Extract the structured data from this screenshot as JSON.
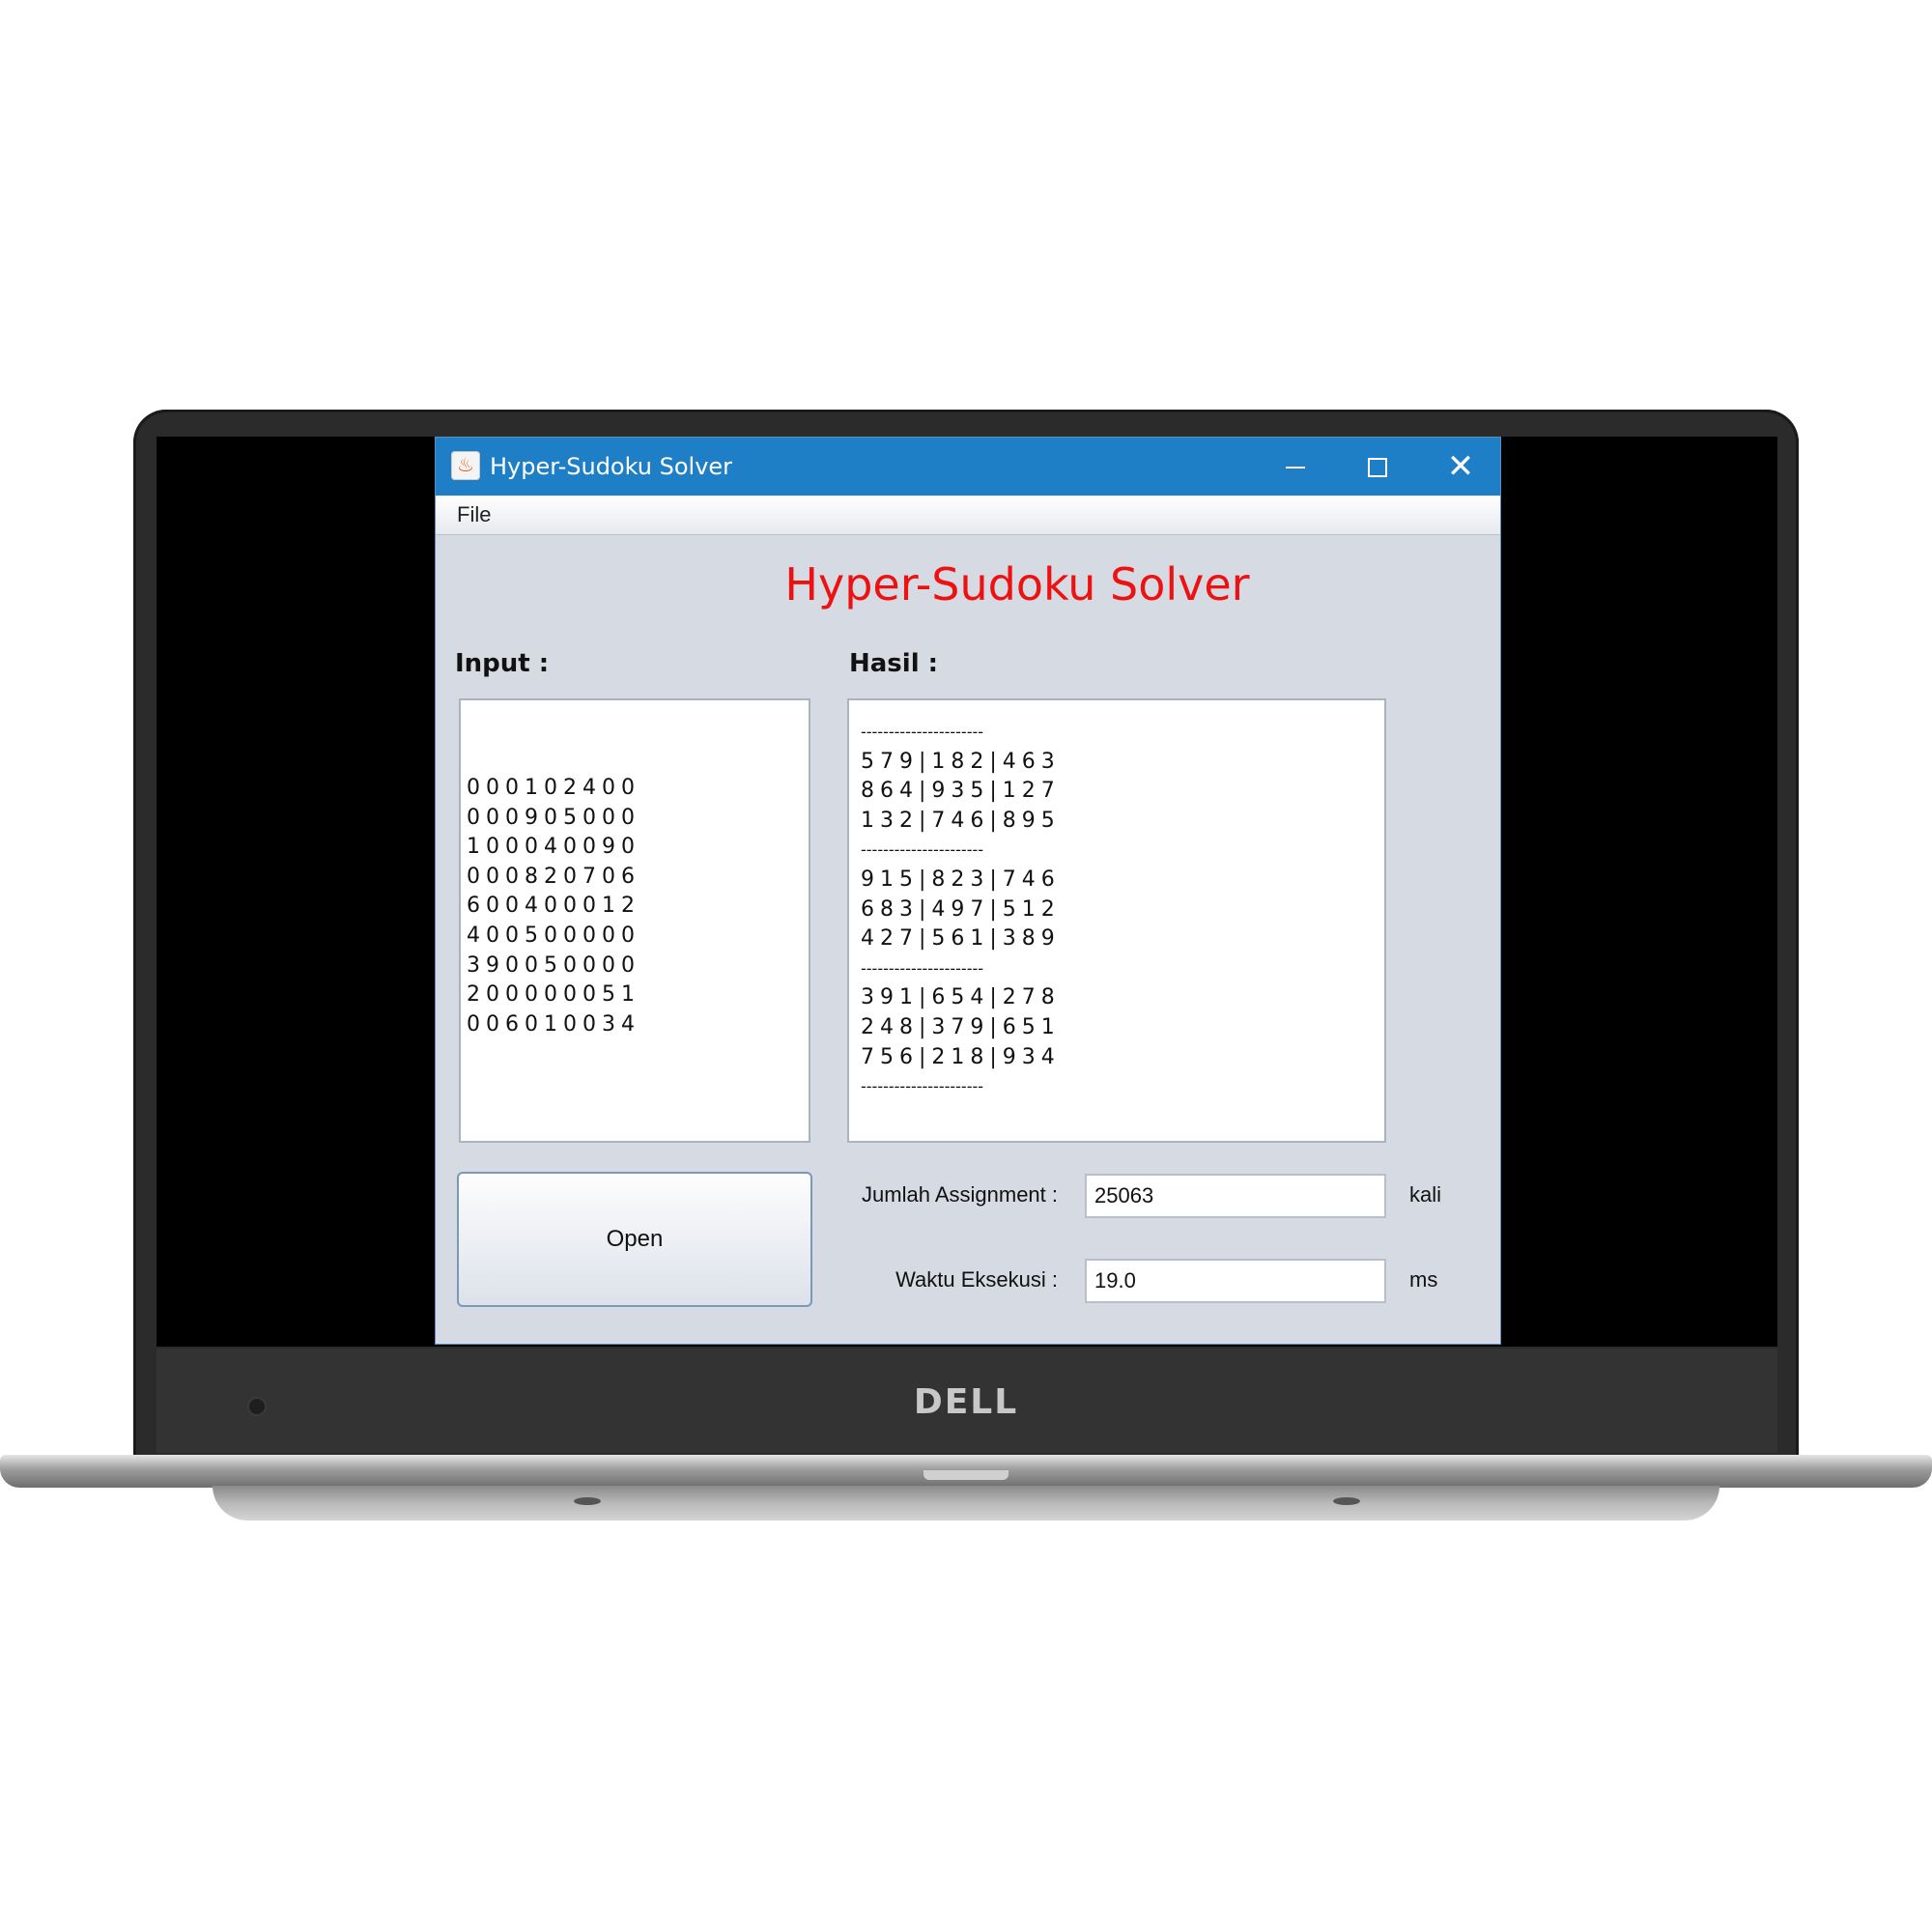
{
  "device": {
    "brand_logo": "DELL"
  },
  "window": {
    "title": "Hyper-Sudoku Solver",
    "icon": "java-cup-icon",
    "controls": {
      "minimize_icon": "minimize-icon",
      "maximize_icon": "maximize-icon",
      "close_icon": "close-icon",
      "close_glyph": "✕"
    }
  },
  "menu": {
    "items": [
      "File"
    ]
  },
  "app": {
    "heading": "Hyper-Sudoku Solver",
    "heading_color": "#ee1111",
    "input_label": "Input :",
    "result_label": "Hasil :",
    "input_lines": [
      "000102400",
      "000905000",
      "100040090",
      "000820706",
      "600400012",
      "400500000",
      "390050000",
      "200000051",
      "006010034"
    ],
    "result_lines": [
      "----------------------",
      "579|182|463",
      "864|935|127",
      "132|746|895",
      "----------------------",
      "915|823|746",
      "683|497|512",
      "427|561|389",
      "----------------------",
      "391|654|278",
      "248|379|651",
      "756|218|934",
      "----------------------"
    ],
    "open_button": "Open",
    "assignment_label": "Jumlah Assignment :",
    "assignment_value": "25063",
    "assignment_unit": "kali",
    "time_label": "Waktu Eksekusi :",
    "time_value": "19.0",
    "time_unit": "ms"
  },
  "colors": {
    "title_bar": "#1f7fc6",
    "window_bg": "#d6dae2"
  }
}
